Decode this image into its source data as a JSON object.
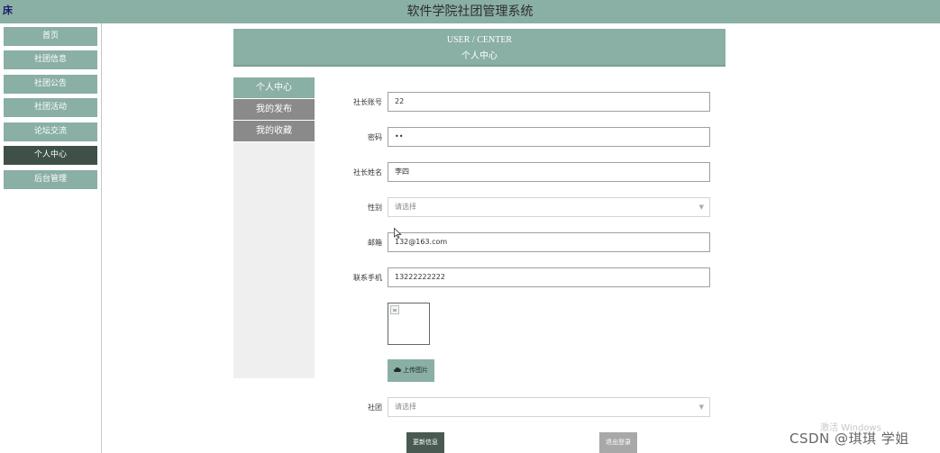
{
  "header": {
    "title": "软件学院社团管理系统",
    "logo_glyph": "床"
  },
  "sidebar": {
    "items": [
      {
        "label": "首页"
      },
      {
        "label": "社团信息"
      },
      {
        "label": "社团公告"
      },
      {
        "label": "社团活动"
      },
      {
        "label": "论坛交流"
      },
      {
        "label": "个人中心",
        "active": true
      },
      {
        "label": "后台管理"
      }
    ]
  },
  "page_header": {
    "english": "USER / CENTER",
    "chinese": "个人中心"
  },
  "subnav": {
    "items": [
      {
        "label": "个人中心",
        "active": true
      },
      {
        "label": "我的发布"
      },
      {
        "label": "我的收藏"
      }
    ]
  },
  "form": {
    "account": {
      "label": "社长账号",
      "value": "22"
    },
    "password": {
      "label": "密码",
      "value": "••"
    },
    "name": {
      "label": "社长姓名",
      "value": "李四"
    },
    "gender": {
      "label": "性别",
      "placeholder": "请选择"
    },
    "email": {
      "label": "邮箱",
      "value": "132@163.com"
    },
    "phone": {
      "label": "联系手机",
      "value": "13222222222"
    },
    "upload_button": "上传图片",
    "club": {
      "label": "社团",
      "placeholder": "请选择"
    }
  },
  "actions": {
    "update": "更新信息",
    "logout": "退出登录"
  },
  "watermarks": {
    "windows": "激活 Windows",
    "csdn": "CSDN @琪琪 学姐"
  },
  "colors": {
    "accent": "#8aafa5",
    "sidebar_active": "#3e5048",
    "inactive_tab": "#8a8a8a",
    "update_button": "#4a5a52",
    "logout_button": "#a8a8a8"
  }
}
